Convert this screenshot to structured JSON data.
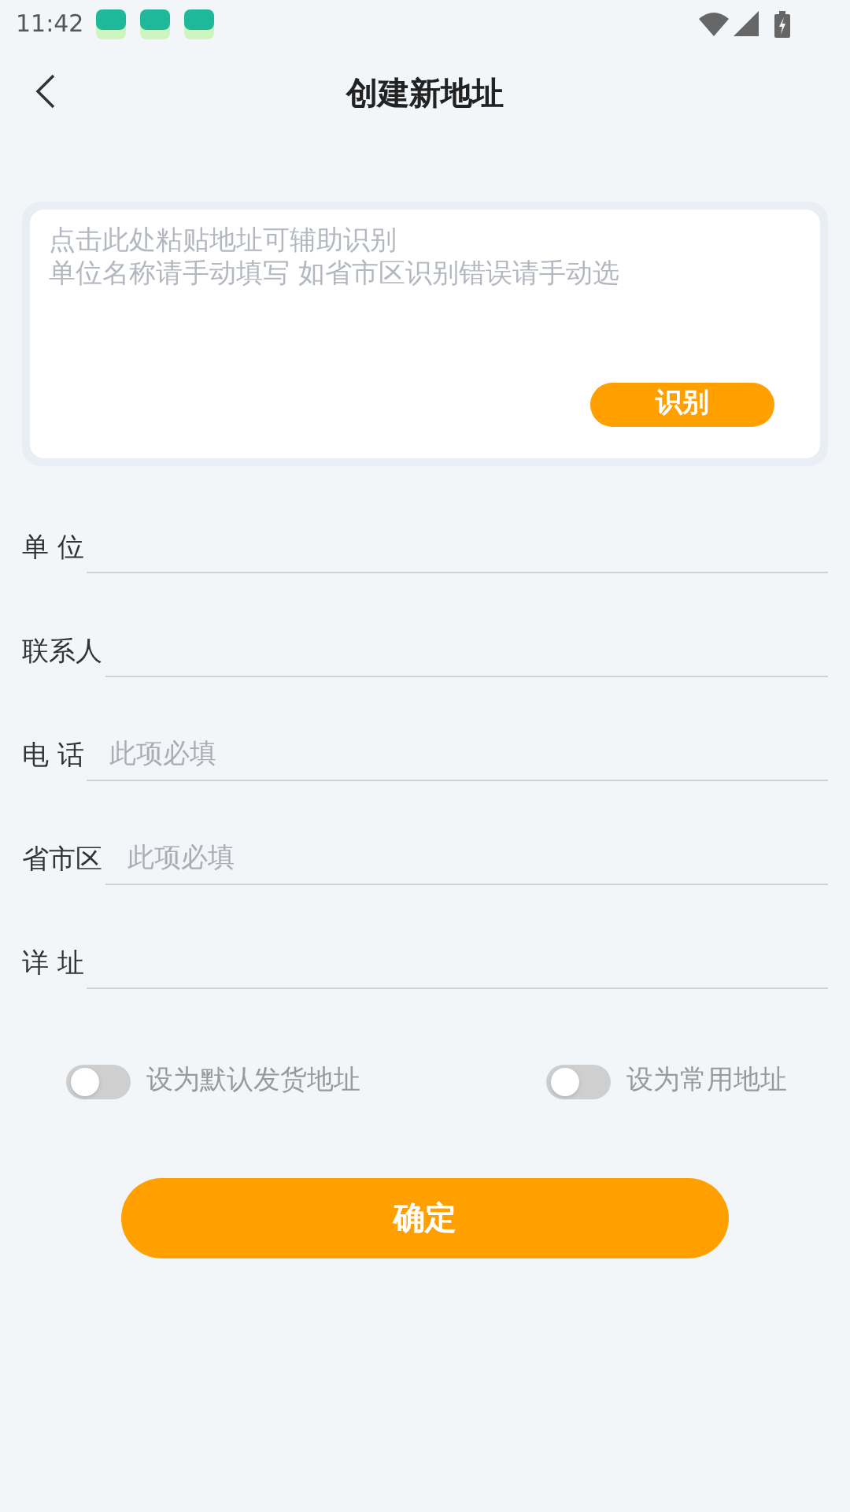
{
  "status_bar": {
    "time": "11:42"
  },
  "header": {
    "title": "创建新地址"
  },
  "paste_box": {
    "placeholder": [
      "点击此处粘贴地址可辅助识别",
      "单位名称请手动填写 如省市区识别错误请手动选"
    ],
    "button": "识别"
  },
  "fields": [
    {
      "label": "单 位"
    },
    {
      "label": "联系人"
    },
    {
      "label": "电 话",
      "placeholder": "此项必填"
    },
    {
      "label": "省市区",
      "placeholder": "此项必填"
    },
    {
      "label": "详 址"
    }
  ],
  "toggles": [
    {
      "label": "设为默认发货地址",
      "on": false
    },
    {
      "label": "设为常用地址",
      "on": false
    }
  ],
  "submit": "确定"
}
